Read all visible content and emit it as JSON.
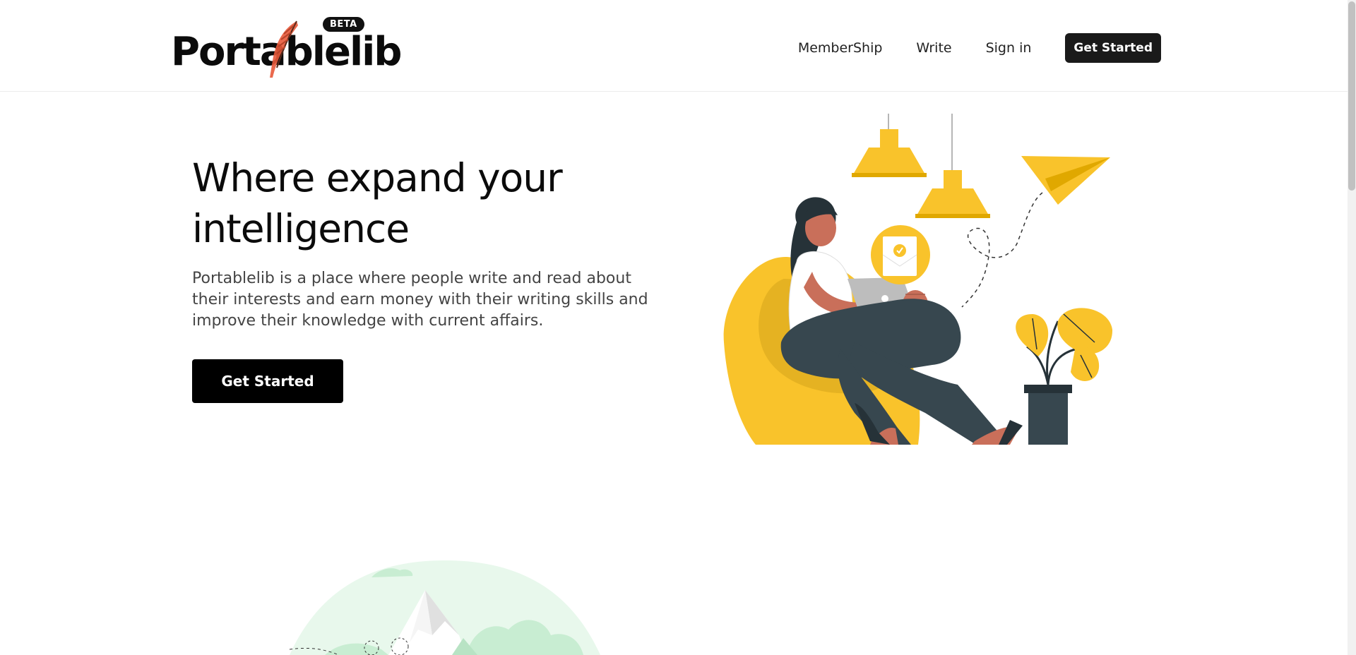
{
  "header": {
    "logo_text": "Portablelib",
    "beta_badge": "BETA",
    "nav": {
      "membership": "MemberShip",
      "write": "Write",
      "sign_in": "Sign in",
      "get_started": "Get Started"
    }
  },
  "hero": {
    "title": "Where expand your intelligence",
    "description": "Portablelib is a place where people write and read about their interests and earn money with their writing skills and improve their knowledge with current affairs.",
    "cta_label": "Get Started"
  },
  "icons": {
    "logo_feather": "feather-icon",
    "hero_art": "woman-reading-illustration",
    "second_art": "mountain-illustration"
  },
  "colors": {
    "accent_yellow": "#F9C32B",
    "dark_slate": "#37474F",
    "skin": "#C96F5A",
    "cta_black": "#000000",
    "mint": "#E8F8EC"
  }
}
